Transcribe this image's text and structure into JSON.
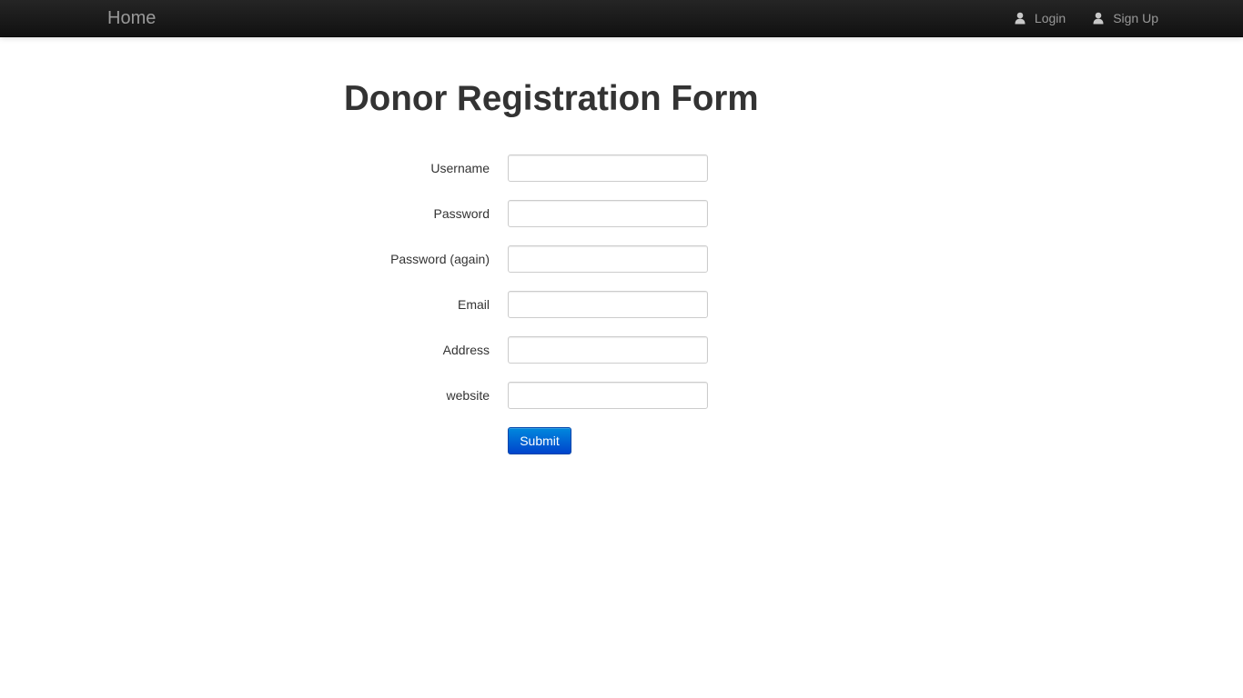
{
  "navbar": {
    "brand": "Home",
    "links": [
      {
        "label": "Login",
        "icon": "user-icon"
      },
      {
        "label": "Sign Up",
        "icon": "user-icon"
      }
    ]
  },
  "page": {
    "title": "Donor Registration Form"
  },
  "form": {
    "fields": [
      {
        "label": "Username",
        "value": "",
        "placeholder": ""
      },
      {
        "label": "Password",
        "value": "",
        "placeholder": ""
      },
      {
        "label": "Password (again)",
        "value": "",
        "placeholder": ""
      },
      {
        "label": "Email",
        "value": "",
        "placeholder": ""
      },
      {
        "label": "Address",
        "value": "",
        "placeholder": ""
      },
      {
        "label": "website",
        "value": "",
        "placeholder": ""
      }
    ],
    "submit_label": "Submit"
  },
  "colors": {
    "navbar_bg": "#1b1b1b",
    "nav_text": "#999999",
    "primary_button": "#006dcc",
    "text": "#333333"
  }
}
